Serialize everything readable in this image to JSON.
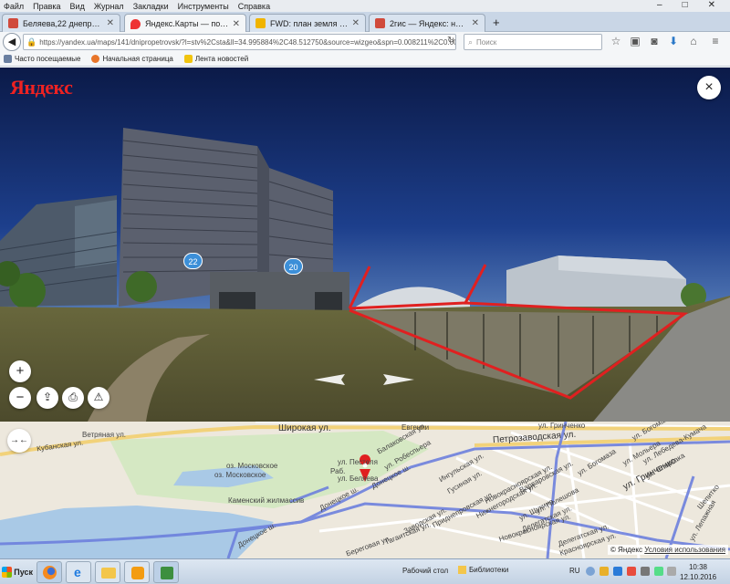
{
  "browser": {
    "menu": [
      "Файл",
      "Правка",
      "Вид",
      "Журнал",
      "Закладки",
      "Инструменты",
      "Справка"
    ],
    "window_controls": [
      "–",
      "□",
      "✕"
    ],
    "tabs": [
      {
        "label": "Беляева,22 днепропетровс...",
        "icon_color": "#d04a3c",
        "active": false
      },
      {
        "label": "Яндекс.Карты — подробна...",
        "icon_color": "#e33",
        "active": true
      },
      {
        "label": "FWD: план земля - Почта М...",
        "icon_color": "#f0b400",
        "active": false
      },
      {
        "label": "2гис — Яндекс: нашлось 2 м...",
        "icon_color": "#d04a3c",
        "active": false
      }
    ],
    "new_tab": "+",
    "url": "https://yandex.ua/maps/141/dnipropetrovsk/?l=stv%2Csta&ll=34.995884%2C48.512750&source=wizgeo&spn=0.008211%2C0.005²",
    "search_placeholder": "Поиск",
    "bookmarks": [
      {
        "label": "Часто посещаемые",
        "icon_color": "#6a7fa0"
      },
      {
        "label": "Начальная страница",
        "icon_color": "#e8752a"
      },
      {
        "label": "Лента новостей",
        "icon_color": "#f1c40f"
      }
    ]
  },
  "panorama": {
    "logo": "Яндекс",
    "close": "×",
    "house_numbers": [
      "22",
      "20"
    ],
    "controls": {
      "zoom_in": "+",
      "zoom_out": "−"
    },
    "accent": "#3c8fd8",
    "annotation_color": "#e02020"
  },
  "map": {
    "collapse": "→←",
    "labels": {
      "shirokaya": "Широкая ул.",
      "petrozavodskaya": "Петрозаводская ул.",
      "grinchenko": "ул. Гринченко",
      "vetryanaya": "Ветряная ул.",
      "kubanskaya": "Кубанская ул.",
      "oz_moskovskoe": "оз. Московское",
      "oz_moskovskoe2": "оз. Московское",
      "kamensky": "Каменский жилмассив",
      "pestelya": "ул. Пестеля",
      "belyaeva": "ул. Беляева",
      "donetskoe": "Донецкое ш.",
      "donetskoe2": "Донецкое ш.",
      "donetskoe3": "Донецкое ш.",
      "balakovskaya": "Балаковская ул.",
      "robespiera": "ул. Робеспьера",
      "ingulskaya": "Ингульская ул.",
      "gusinaya": "Гусиная ул.",
      "varvarovskaya": "Варваровская ул.",
      "novokrasnoyarskaya": "Новокрасноярская ул.",
      "novokrasnoyarskaya2": "Новокрасноярская ул.",
      "nizhnegorodskaya": "Нижнегородская ул.",
      "pridneprovskaya": "Приднепровская ул.",
      "zavodskaya": "Заводская ул.",
      "tagaitskaya": "Тагаитская ул.",
      "beregovaya": "Береговая ул.",
      "delegatskaya": "Делегатская ул.",
      "delegatskaya2": "Делегатская ул.",
      "poleshova": "ул. Полешова",
      "shchukina": "ул. Щукина",
      "sbbogoma": "ул. Богомаза",
      "bogoma2": "ул. Богомаза",
      "molyera": "ул. Мольера",
      "spartaka": "ул. Спартака",
      "lebedeva": "ул. Лебедева-Кумача",
      "lepazhnaya": "ул. Лепажная",
      "grinchenko2": "ул. Гринченко",
      "krasnoyarskaya": "Красноярская ул.",
      "shepitko": "Шепитко",
      "evgeniya": "Евгении",
      "rab": "Раб."
    },
    "copyright": "© Яндекс",
    "terms": "Условия использования"
  },
  "taskbar": {
    "start": "Пуск",
    "desktop": "Рабочий стол",
    "libraries": "Библиотеки",
    "lang": "RU",
    "time": "10:38",
    "date": "12.10.2016"
  }
}
